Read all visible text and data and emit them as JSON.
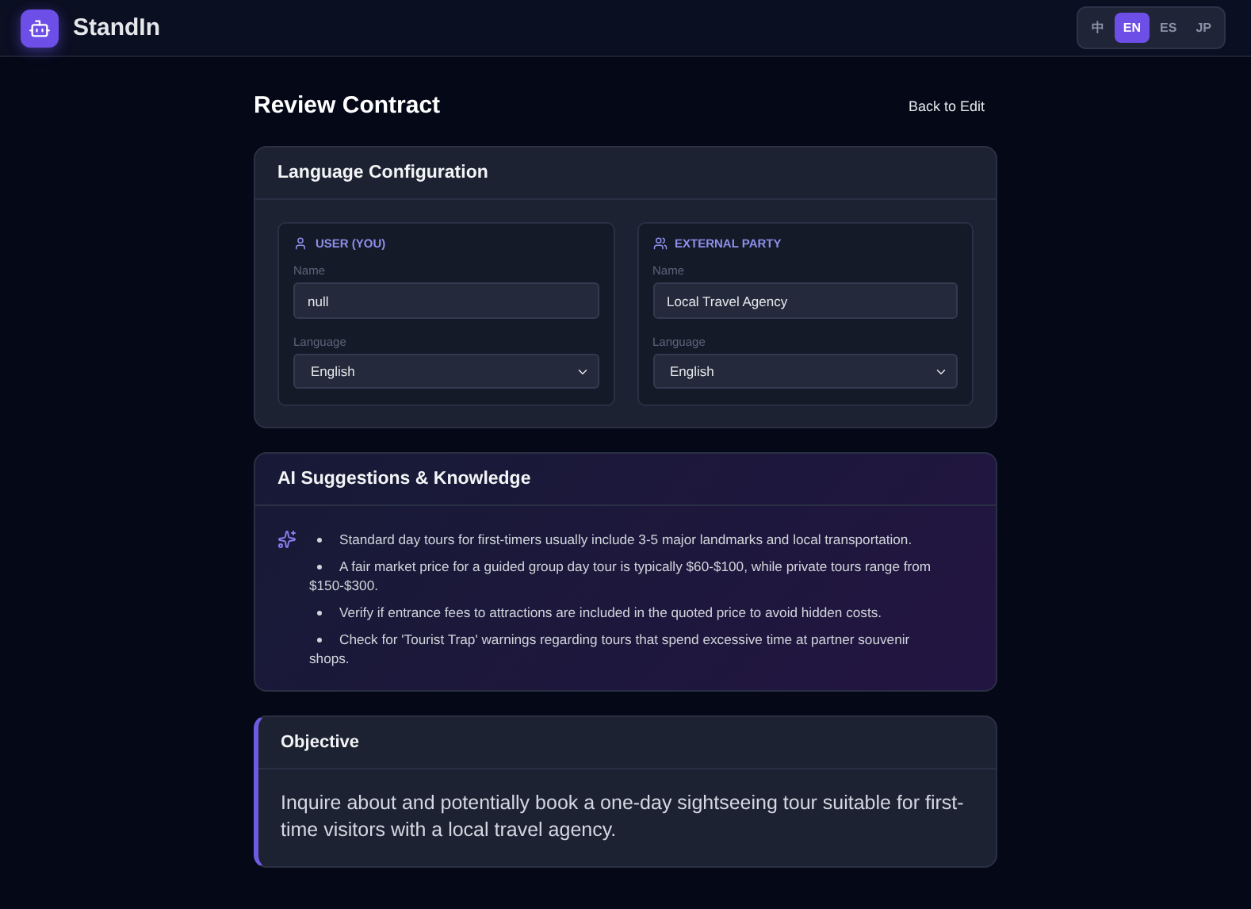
{
  "app": {
    "name": "StandIn"
  },
  "languages": [
    {
      "label": "中",
      "selected": false
    },
    {
      "label": "EN",
      "selected": true
    },
    {
      "label": "ES",
      "selected": false
    },
    {
      "label": "JP",
      "selected": false
    }
  ],
  "page": {
    "title": "Review Contract",
    "back_link": "Back to Edit"
  },
  "language_configuration": {
    "title": "Language Configuration",
    "parties": [
      {
        "kind": "user",
        "heading": "USER (YOU)",
        "name_label": "Name",
        "name_value": "null",
        "language_label": "Language",
        "language_value": "English"
      },
      {
        "kind": "external",
        "heading": "EXTERNAL PARTY",
        "name_label": "Name",
        "name_value": "Local Travel Agency",
        "language_label": "Language",
        "language_value": "English"
      }
    ]
  },
  "suggestions": {
    "title": "AI Suggestions & Knowledge",
    "items": [
      "Standard day tours for first-timers usually include 3-5 major landmarks and local transportation.",
      "A fair market price for a guided group day tour is typically $60-$100, while private tours range from $150-$300.",
      "Verify if entrance fees to attractions are included in the quoted price to avoid hidden costs.",
      "Check for 'Tourist Trap' warnings regarding tours that spend excessive time at partner souvenir shops."
    ]
  },
  "objective": {
    "title": "Objective",
    "text": "Inquire about and potentially book a one-day sightseeing tour suitable for first-time visitors with a local travel agency."
  }
}
